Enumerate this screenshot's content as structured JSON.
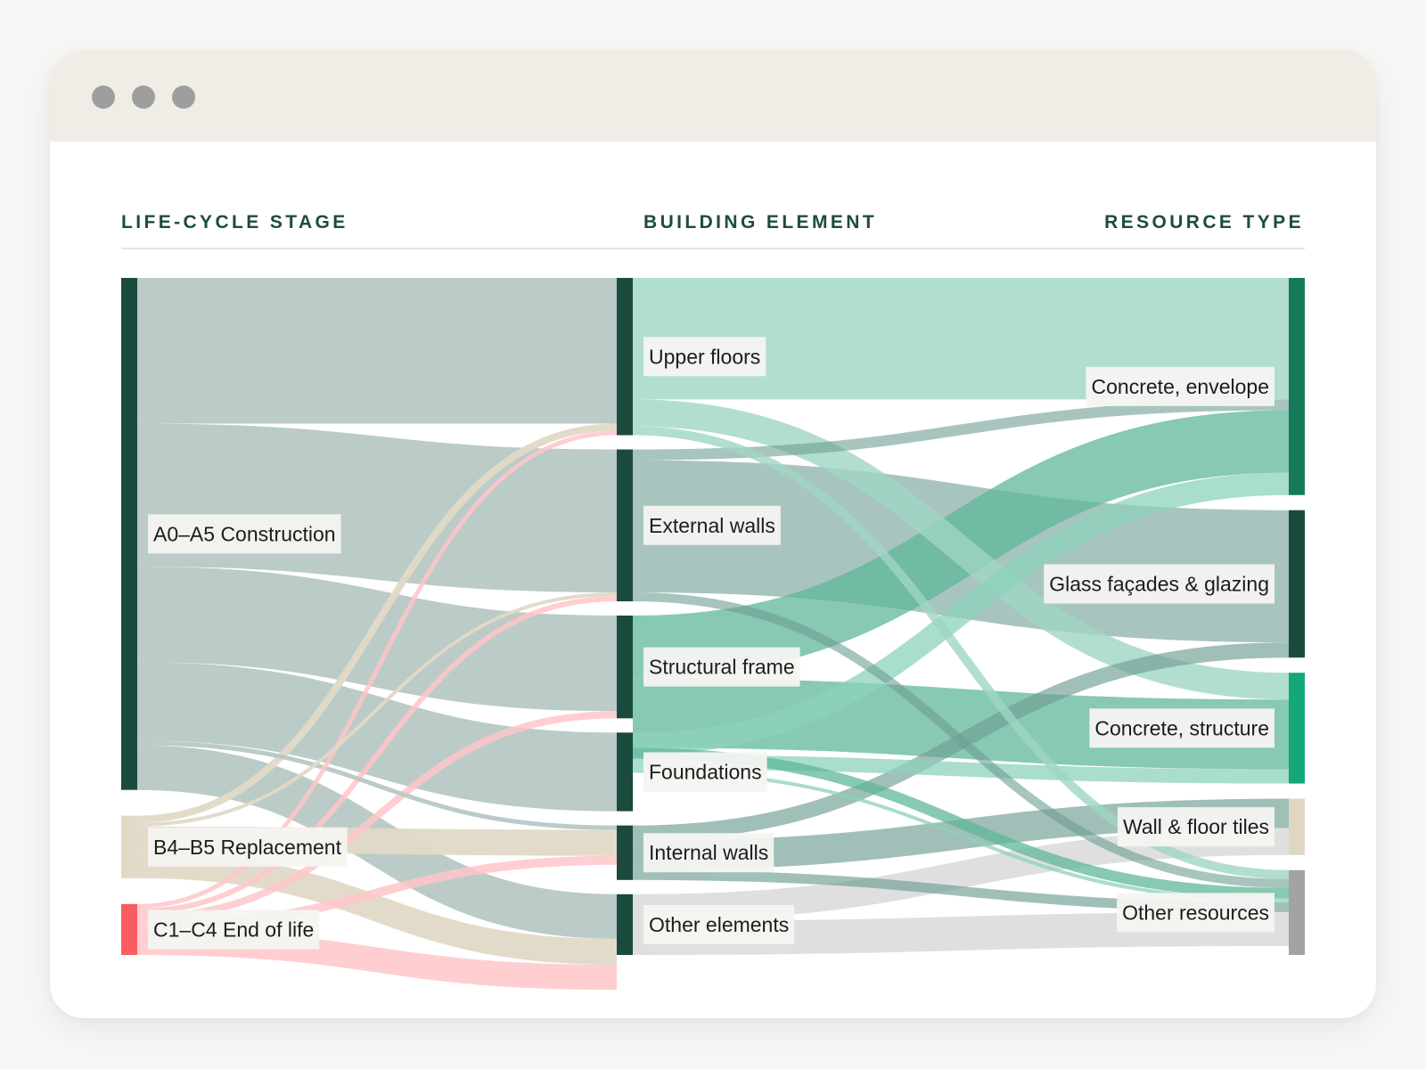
{
  "window": {
    "controls": [
      "close",
      "minimize",
      "maximize"
    ]
  },
  "headers": {
    "stage": "LIFE-CYCLE STAGE",
    "element": "BUILDING ELEMENT",
    "resource": "RESOURCE TYPE"
  },
  "chart_data": {
    "type": "sankey",
    "title": "",
    "columns": [
      "LIFE-CYCLE STAGE",
      "BUILDING ELEMENT",
      "RESOURCE TYPE"
    ],
    "nodes": [
      {
        "id": "a0a5",
        "label": "A0–A5 Construction",
        "column": 0,
        "value": 573,
        "color": "#1a4b3e",
        "label_side": "right"
      },
      {
        "id": "b4b5",
        "label": "B4–B5 Replacement",
        "column": 0,
        "value": 70,
        "color": "#e2d9c7",
        "label_side": "right"
      },
      {
        "id": "c1c4",
        "label": "C1–C4 End of life",
        "column": 0,
        "value": 57,
        "color": "#fa5c62",
        "label_side": "right"
      },
      {
        "id": "upper",
        "label": "Upper floors",
        "column": 1,
        "value": 176,
        "color": "#1a4b3e",
        "label_side": "right"
      },
      {
        "id": "extw",
        "label": "External walls",
        "column": 1,
        "value": 170,
        "color": "#1a4b3e",
        "label_side": "right"
      },
      {
        "id": "frame",
        "label": "Structural frame",
        "column": 1,
        "value": 115,
        "color": "#1a4b3e",
        "label_side": "right"
      },
      {
        "id": "found",
        "label": "Foundations",
        "column": 1,
        "value": 88,
        "color": "#1a4b3e",
        "label_side": "right"
      },
      {
        "id": "intw",
        "label": "Internal walls",
        "column": 1,
        "value": 61,
        "color": "#1a4b3e",
        "label_side": "right"
      },
      {
        "id": "other",
        "label": "Other elements",
        "column": 1,
        "value": 68,
        "color": "#1a4b3e",
        "label_side": "right"
      },
      {
        "id": "conc_env",
        "label": "Concrete, envelope",
        "column": 2,
        "value": 243,
        "color": "#147a5b",
        "label_side": "left"
      },
      {
        "id": "glass",
        "label": "Glass façades & glazing",
        "column": 2,
        "value": 165,
        "color": "#1a4b3e",
        "label_side": "left"
      },
      {
        "id": "conc_str",
        "label": "Concrete, structure",
        "column": 2,
        "value": 124,
        "color": "#15a67a",
        "label_side": "left"
      },
      {
        "id": "tiles",
        "label": "Wall & floor tiles",
        "column": 2,
        "value": 63,
        "color": "#e0d7c3",
        "label_side": "left"
      },
      {
        "id": "otherres",
        "label": "Other resources",
        "column": 2,
        "value": 95,
        "color": "#a3a3a3",
        "label_side": "left"
      }
    ],
    "links": [
      {
        "source": "a0a5",
        "target": "upper",
        "value": 163
      },
      {
        "source": "a0a5",
        "target": "extw",
        "value": 160
      },
      {
        "source": "a0a5",
        "target": "frame",
        "value": 107
      },
      {
        "source": "a0a5",
        "target": "found",
        "value": 88
      },
      {
        "source": "a0a5",
        "target": "intw",
        "value": 5
      },
      {
        "source": "a0a5",
        "target": "other",
        "value": 50
      },
      {
        "source": "b4b5",
        "target": "upper",
        "value": 8
      },
      {
        "source": "b4b5",
        "target": "extw",
        "value": 4
      },
      {
        "source": "b4b5",
        "target": "intw",
        "value": 29
      },
      {
        "source": "b4b5",
        "target": "other",
        "value": 29
      },
      {
        "source": "c1c4",
        "target": "upper",
        "value": 5
      },
      {
        "source": "c1c4",
        "target": "extw",
        "value": 6
      },
      {
        "source": "c1c4",
        "target": "frame",
        "value": 8
      },
      {
        "source": "c1c4",
        "target": "intw",
        "value": 10
      },
      {
        "source": "c1c4",
        "target": "other",
        "value": 28
      },
      {
        "source": "upper",
        "target": "conc_env",
        "value": 136
      },
      {
        "source": "upper",
        "target": "conc_str",
        "value": 30
      },
      {
        "source": "upper",
        "target": "otherres",
        "value": 10
      },
      {
        "source": "extw",
        "target": "glass",
        "value": 148
      },
      {
        "source": "extw",
        "target": "conc_env",
        "value": 12
      },
      {
        "source": "extw",
        "target": "otherres",
        "value": 10
      },
      {
        "source": "frame",
        "target": "conc_env",
        "value": 70
      },
      {
        "source": "frame",
        "target": "conc_str",
        "value": 78
      },
      {
        "source": "frame",
        "target": "otherres",
        "value": 12
      },
      {
        "source": "found",
        "target": "conc_env",
        "value": 25
      },
      {
        "source": "found",
        "target": "conc_str",
        "value": 16
      },
      {
        "source": "found",
        "target": "otherres",
        "value": 4
      },
      {
        "source": "intw",
        "target": "glass",
        "value": 17
      },
      {
        "source": "intw",
        "target": "tiles",
        "value": 33
      },
      {
        "source": "intw",
        "target": "otherres",
        "value": 11
      },
      {
        "source": "other",
        "target": "tiles",
        "value": 30
      },
      {
        "source": "other",
        "target": "otherres",
        "value": 38
      }
    ]
  }
}
